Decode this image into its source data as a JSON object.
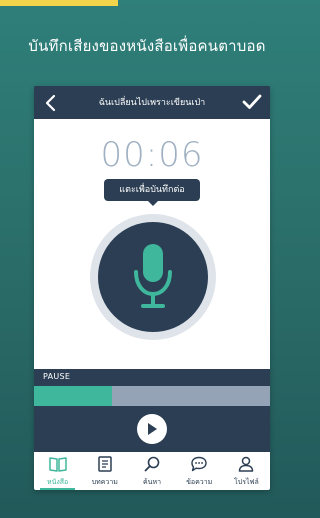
{
  "headline": "บันทึกเสียงของหนังสือเพื่อคนตาบอด",
  "topbar": {
    "title": "ฉันเปลี่ยนไปเพราะเขียนเป่า",
    "back_icon": "chevron-left-icon",
    "done_icon": "check-icon"
  },
  "recorder": {
    "timer": "00:06",
    "tooltip": "แตะเพื่อบันทึกต่อ",
    "mic_icon": "microphone-icon"
  },
  "pause": {
    "label": "PAUSE"
  },
  "progress": {
    "value": 0.33
  },
  "tabs": [
    {
      "label": "หนังสือ",
      "icon": "book-icon",
      "active": true
    },
    {
      "label": "บทความ",
      "icon": "article-icon",
      "active": false
    },
    {
      "label": "ค้นหา",
      "icon": "search-icon",
      "active": false
    },
    {
      "label": "ข้อความ",
      "icon": "message-icon",
      "active": false
    },
    {
      "label": "โปรไฟล์",
      "icon": "profile-icon",
      "active": false
    }
  ],
  "colors": {
    "accent": "#3fb79c",
    "navy": "#2b3e53",
    "yellow": "#f2d54b",
    "background": "#2f7f7a"
  }
}
